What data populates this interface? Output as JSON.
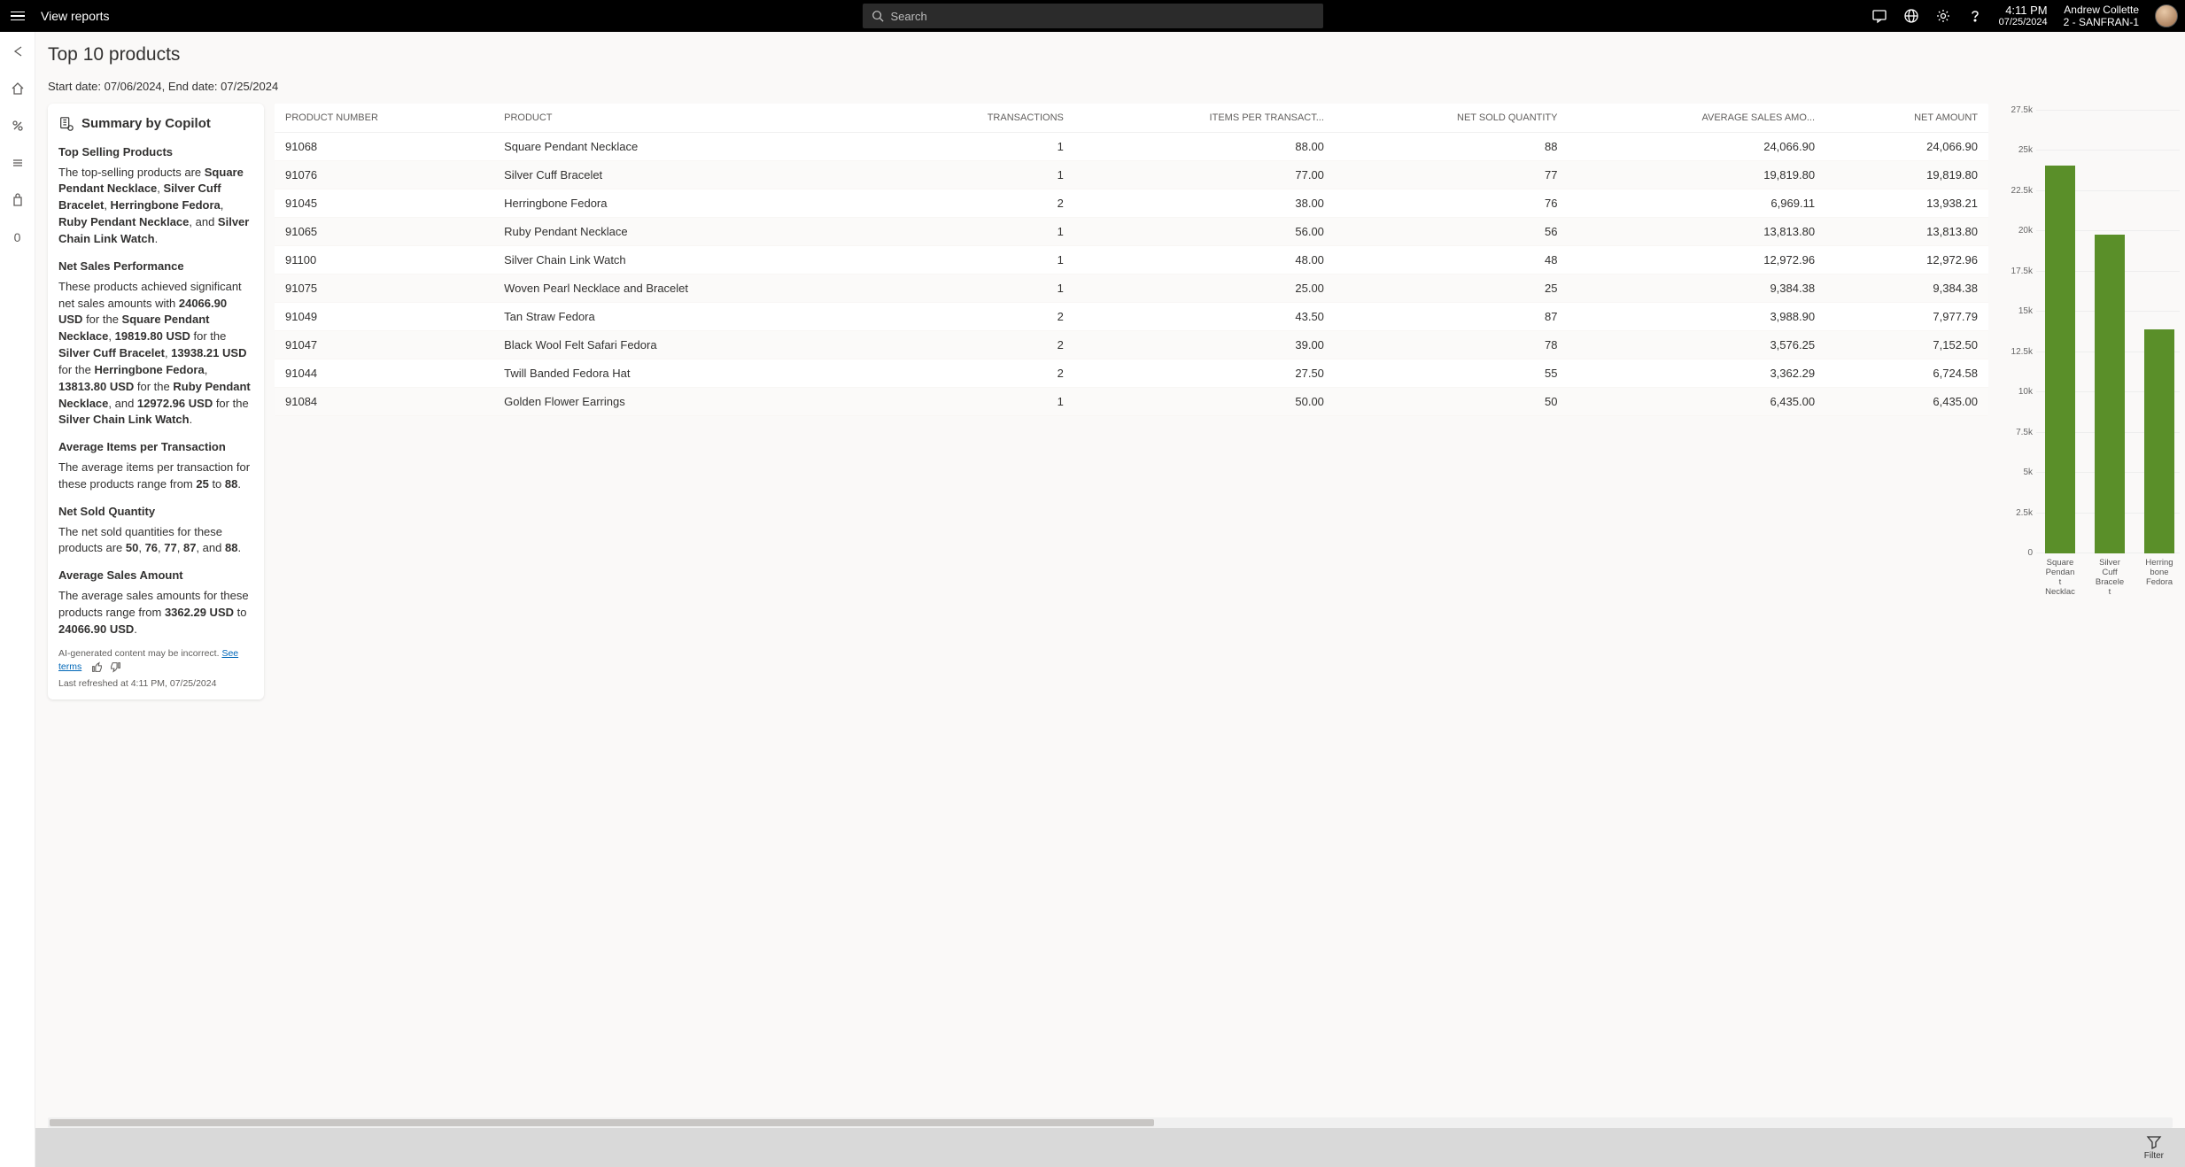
{
  "topbar": {
    "title": "View reports",
    "search_placeholder": "Search",
    "time": "4:11 PM",
    "date": "07/25/2024",
    "user_name": "Andrew Collette",
    "user_sub": "2 - SANFRAN-1"
  },
  "leftrail": {
    "badge": "0"
  },
  "header": {
    "title": "Top 10 products",
    "date_range": "Start date: 07/06/2024, End date: 07/25/2024"
  },
  "copilot": {
    "title": "Summary by Copilot",
    "sections": {
      "top_selling_heading": "Top Selling Products",
      "top_selling_text_pre": "The top-selling products are ",
      "net_sales_heading": "Net Sales Performance",
      "net_sales_text": "These products achieved significant net sales amounts with ",
      "avg_items_heading": "Average Items per Transaction",
      "avg_items_text_pre": "The average items per transaction for these products range from ",
      "avg_items_low": "25",
      "avg_items_to": " to ",
      "avg_items_high": "88",
      "net_sold_heading": "Net Sold Quantity",
      "net_sold_text": "The net sold quantities for these products are ",
      "net_sold_values": "50, 76, 77, 87, and 88.",
      "avg_sales_heading": "Average Sales Amount",
      "avg_sales_text_pre": "The average sales amounts for these products range from ",
      "avg_sales_low": "3362.29 USD",
      "avg_sales_to": " to ",
      "avg_sales_high": "24066.90 USD"
    },
    "top_products_bold": [
      "Square Pendant Necklace",
      "Silver Cuff Bracelet",
      "Herringbone Fedora",
      "Ruby Pendant Necklace",
      "Silver Chain Link Watch"
    ],
    "net_sales_pairs": [
      {
        "amount": "24066.90 USD",
        "product": "Square Pendant Necklace"
      },
      {
        "amount": "19819.80 USD",
        "product": "Silver Cuff Bracelet"
      },
      {
        "amount": "13938.21 USD",
        "product": "Herringbone Fedora"
      },
      {
        "amount": "13813.80 USD",
        "product": "Ruby Pendant Necklace"
      },
      {
        "amount": "12972.96 USD",
        "product": "Silver Chain Link Watch"
      }
    ],
    "ai_note": "AI-generated content may be incorrect.",
    "see_terms": "See terms",
    "refreshed": "Last refreshed at 4:11 PM, 07/25/2024"
  },
  "table": {
    "columns": [
      "PRODUCT NUMBER",
      "PRODUCT",
      "TRANSACTIONS",
      "ITEMS PER TRANSACT...",
      "NET SOLD QUANTITY",
      "AVERAGE SALES AMO...",
      "NET AMOUNT"
    ],
    "rows": [
      {
        "num": "91068",
        "product": "Square Pendant Necklace",
        "tx": "1",
        "ipt": "88.00",
        "nsq": "88",
        "asa": "24,066.90",
        "na": "24,066.90"
      },
      {
        "num": "91076",
        "product": "Silver Cuff Bracelet",
        "tx": "1",
        "ipt": "77.00",
        "nsq": "77",
        "asa": "19,819.80",
        "na": "19,819.80"
      },
      {
        "num": "91045",
        "product": "Herringbone Fedora",
        "tx": "2",
        "ipt": "38.00",
        "nsq": "76",
        "asa": "6,969.11",
        "na": "13,938.21"
      },
      {
        "num": "91065",
        "product": "Ruby Pendant Necklace",
        "tx": "1",
        "ipt": "56.00",
        "nsq": "56",
        "asa": "13,813.80",
        "na": "13,813.80"
      },
      {
        "num": "91100",
        "product": "Silver Chain Link Watch",
        "tx": "1",
        "ipt": "48.00",
        "nsq": "48",
        "asa": "12,972.96",
        "na": "12,972.96"
      },
      {
        "num": "91075",
        "product": "Woven Pearl Necklace and Bracelet",
        "tx": "1",
        "ipt": "25.00",
        "nsq": "25",
        "asa": "9,384.38",
        "na": "9,384.38"
      },
      {
        "num": "91049",
        "product": "Tan Straw Fedora",
        "tx": "2",
        "ipt": "43.50",
        "nsq": "87",
        "asa": "3,988.90",
        "na": "7,977.79"
      },
      {
        "num": "91047",
        "product": "Black Wool Felt Safari Fedora",
        "tx": "2",
        "ipt": "39.00",
        "nsq": "78",
        "asa": "3,576.25",
        "na": "7,152.50"
      },
      {
        "num": "91044",
        "product": "Twill Banded Fedora Hat",
        "tx": "2",
        "ipt": "27.50",
        "nsq": "55",
        "asa": "3,362.29",
        "na": "6,724.58"
      },
      {
        "num": "91084",
        "product": "Golden Flower Earrings",
        "tx": "1",
        "ipt": "50.00",
        "nsq": "50",
        "asa": "6,435.00",
        "na": "6,435.00"
      }
    ]
  },
  "chart_data": {
    "type": "bar",
    "categories": [
      "Square Pendant Necklace",
      "Silver Cuff Bracelet",
      "Herringbone Fedora"
    ],
    "values": [
      24066.9,
      19819.8,
      13938.21
    ],
    "title": "",
    "xlabel": "",
    "ylabel": "",
    "ylim": [
      0,
      27500
    ],
    "yticks": [
      0,
      2500,
      5000,
      7500,
      10000,
      12500,
      15000,
      17500,
      20000,
      22500,
      25000,
      27500
    ],
    "ytick_labels": [
      "0",
      "2.5k",
      "5k",
      "7.5k",
      "10k",
      "12.5k",
      "15k",
      "17.5k",
      "20k",
      "22.5k",
      "25k",
      "27.5k"
    ],
    "bar_color": "#5a8f29"
  },
  "footer": {
    "filter_label": "Filter"
  }
}
